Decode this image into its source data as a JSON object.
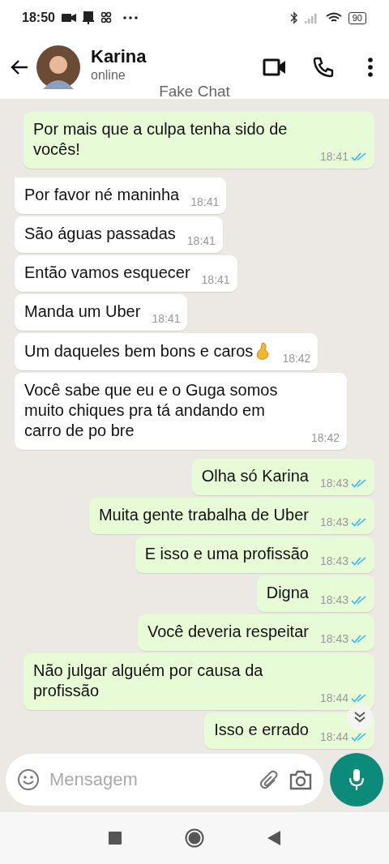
{
  "status_bar": {
    "time": "18:50",
    "battery": "90"
  },
  "header": {
    "name": "Karina",
    "status": "online",
    "overlay": "Fake Chat"
  },
  "messages": [
    {
      "kind": "out",
      "text": "Por mais que a culpa tenha sido de vocês!",
      "time": "18:41",
      "read": true
    },
    {
      "kind": "in",
      "text": "Por favor né maninha",
      "time": "18:41",
      "tail": true
    },
    {
      "kind": "in",
      "text": "São águas passadas",
      "time": "18:41",
      "tail": false
    },
    {
      "kind": "in",
      "text": "Então vamos esquecer",
      "time": "18:41",
      "tail": false
    },
    {
      "kind": "in",
      "text": "Manda um Uber",
      "time": "18:41",
      "tail": false
    },
    {
      "kind": "in",
      "text": "Um daqueles bem bons e caros",
      "emoji": true,
      "time": "18:42",
      "tail": false
    },
    {
      "kind": "in",
      "text": "Você sabe que eu e o Guga somos muito chiques pra tá andando em carro de po bre",
      "time": "18:42",
      "tail": false
    },
    {
      "kind": "out",
      "text": "Olha só Karina",
      "time": "18:43",
      "read": true
    },
    {
      "kind": "out",
      "text": "Muita gente trabalha de Uber",
      "time": "18:43",
      "read": true
    },
    {
      "kind": "out",
      "text": "E isso e uma profissão",
      "time": "18:43",
      "read": true
    },
    {
      "kind": "out",
      "text": "Digna",
      "time": "18:43",
      "read": true
    },
    {
      "kind": "out",
      "text": "Você deveria respeitar",
      "time": "18:43",
      "read": true
    },
    {
      "kind": "out",
      "text": "Não julgar alguém por causa da profissão",
      "time": "18:44",
      "read": true
    },
    {
      "kind": "out",
      "text": "Isso e errado",
      "time": "18:44",
      "read": true
    }
  ],
  "composer": {
    "placeholder": "Mensagem"
  }
}
